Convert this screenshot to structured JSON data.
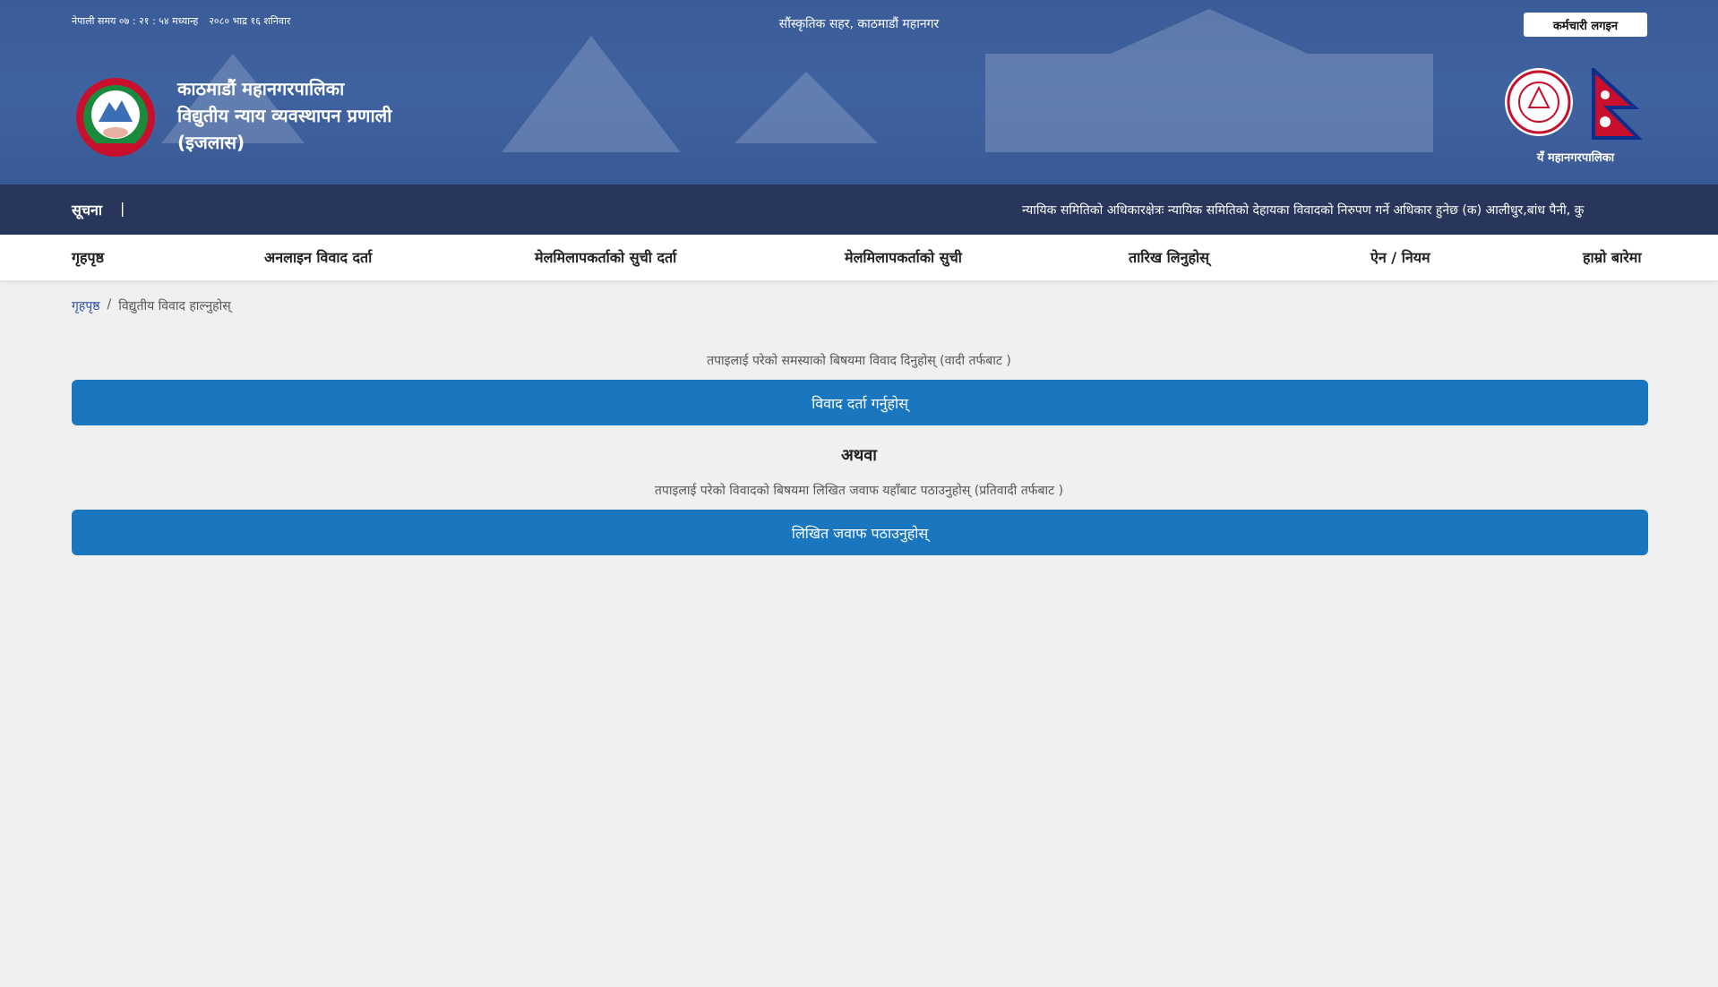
{
  "header": {
    "nepali_time": "नेपाली समय ०७ : २१ : ५४ मध्यान्ह",
    "nepali_date": "२०८० भाद्र १६ शनिवार",
    "tagline": "सौंस्कृतिक सहर, काठमाडौं महानगर",
    "login_label": "कर्मचारी लगइन",
    "title_line1": "काठमाडौं महानगरपालिका",
    "title_line2": "विद्युतीय न्याय व्यवस्थापन प्रणाली",
    "title_line3": "(इजलास)",
    "right_caption": "यँ महानगरपालिका"
  },
  "notice": {
    "label": "सूचना",
    "separator": "|",
    "text": "न्यायिक समितिको अधिकारक्षेत्रः न्यायिक समितिको देहायका विवादको निरुपण गर्ने अधिकार हुनेछ    (क) आलीधुर,बांध पैनी, कु"
  },
  "nav": {
    "items": [
      {
        "label": "गृहपृष्ठ"
      },
      {
        "label": "अनलाइन विवाद दर्ता"
      },
      {
        "label": "मेलमिलापकर्ताको सुची दर्ता"
      },
      {
        "label": "मेलमिलापकर्ताको सुची"
      },
      {
        "label": "तारिख लिनुहोस्"
      },
      {
        "label": "ऐन / नियम"
      },
      {
        "label": "हाम्रो बारेमा"
      }
    ]
  },
  "breadcrumb": {
    "home": "गृहपृष्ठ",
    "separator": "/",
    "current": "विद्युतीय विवाद हाल्नुहोस्"
  },
  "main": {
    "desc1": "तपाइलाई परेको समस्याको बिषयमा विवाद दिनुहोस् (वादी तर्फबाट )",
    "button1": "विवाद दर्ता गर्नुहोस्",
    "or": "अथवा",
    "desc2": "तपाइलाई परेको विवादको बिषयमा लिखित जवाफ यहाँबाट पठाउनुहोस् (प्रतिवादी तर्फबाट )",
    "button2": "लिखित जवाफ पठाउनुहोस्"
  },
  "colors": {
    "header_bg": "#3f62a0",
    "notice_bg": "#27365a",
    "button_bg": "#1a77bf",
    "link": "#2a4fa3"
  },
  "icons": [
    "nepal-emblem-icon",
    "kathmandu-seal-icon",
    "nepal-flag-icon"
  ]
}
